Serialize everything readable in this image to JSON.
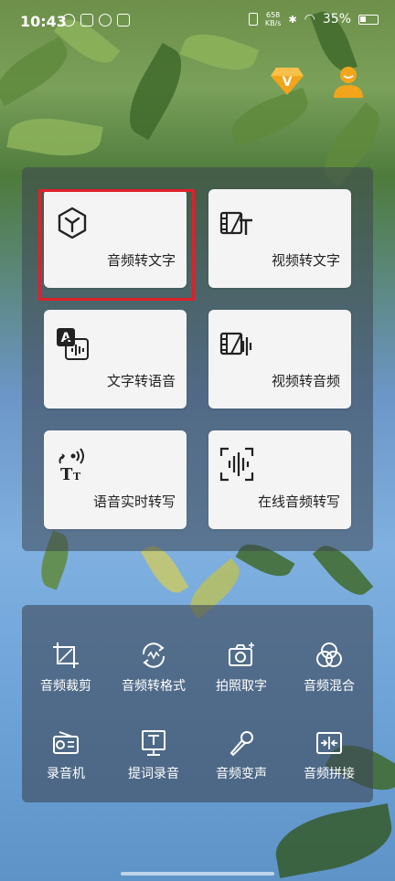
{
  "status_bar": {
    "time": "10:43",
    "net_speed_value": "658",
    "net_speed_unit": "KB/s",
    "battery": "35%"
  },
  "features": [
    {
      "label": "音频转文字",
      "icon": "cube-icon"
    },
    {
      "label": "视频转文字",
      "icon": "video-text-icon"
    },
    {
      "label": "文字转语音",
      "icon": "text-audio-icon"
    },
    {
      "label": "视频转音频",
      "icon": "video-audio-icon"
    },
    {
      "label": "语音实时转写",
      "icon": "live-transcribe-icon"
    },
    {
      "label": "在线音频转写",
      "icon": "online-audio-icon"
    }
  ],
  "tools": [
    {
      "label": "音频裁剪",
      "icon": "crop-icon"
    },
    {
      "label": "音频转格式",
      "icon": "convert-format-icon"
    },
    {
      "label": "拍照取字",
      "icon": "camera-icon"
    },
    {
      "label": "音频混合",
      "icon": "mix-icon"
    },
    {
      "label": "录音机",
      "icon": "radio-recorder-icon"
    },
    {
      "label": "提词录音",
      "icon": "teleprompter-icon"
    },
    {
      "label": "音频变声",
      "icon": "microphone-icon"
    },
    {
      "label": "音频拼接",
      "icon": "merge-icon"
    }
  ],
  "colors": {
    "highlight": "#e0202a",
    "vip_gold": "#f2a51a"
  }
}
